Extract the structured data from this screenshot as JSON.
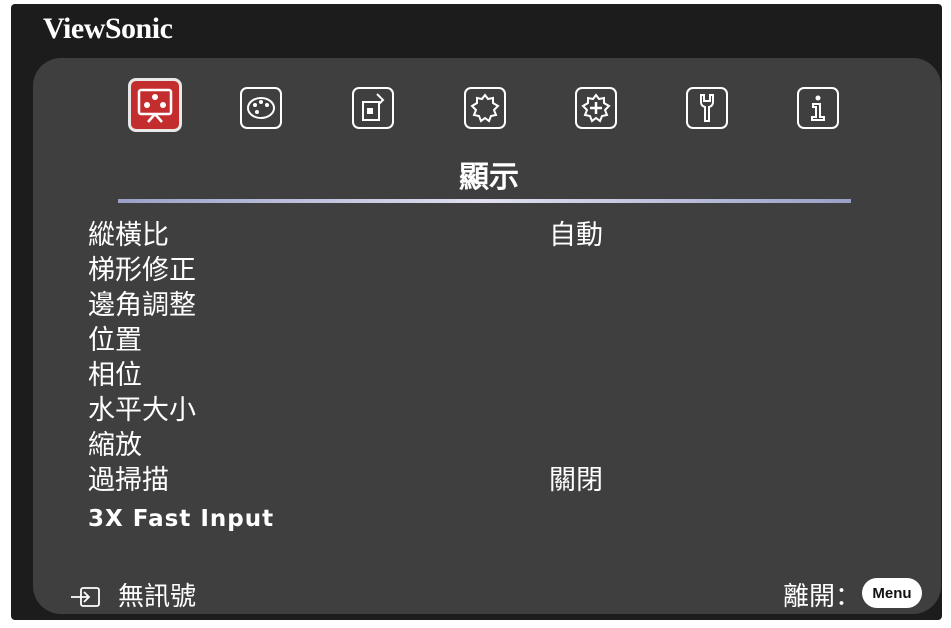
{
  "app": {
    "brand": "ViewSonic"
  },
  "tabs": [
    {
      "icon": "display-icon",
      "active": true
    },
    {
      "icon": "picture-icon",
      "active": false
    },
    {
      "icon": "power-management-icon",
      "active": false
    },
    {
      "icon": "basic-settings-icon",
      "active": false
    },
    {
      "icon": "advanced-settings-icon",
      "active": false
    },
    {
      "icon": "system-icon",
      "active": false
    },
    {
      "icon": "information-icon",
      "active": false
    }
  ],
  "active_tab_title": "顯示",
  "menu": {
    "items": [
      {
        "label": "縱橫比",
        "value": "自動"
      },
      {
        "label": "梯形修正",
        "value": ""
      },
      {
        "label": "邊角調整",
        "value": ""
      },
      {
        "label": "位置",
        "value": ""
      },
      {
        "label": "相位",
        "value": ""
      },
      {
        "label": "水平大小",
        "value": ""
      },
      {
        "label": "縮放",
        "value": ""
      },
      {
        "label": "過掃描",
        "value": "關閉"
      },
      {
        "label": "3X Fast Input",
        "value": ""
      }
    ]
  },
  "footer": {
    "input_icon": "input-source-icon",
    "status": "無訊號",
    "exit_label": "離開：",
    "menu_key": "Menu"
  },
  "colors": {
    "background": "#1c1c1c",
    "panel": "#3f3f3f",
    "active_tab": "#c42d2d",
    "text": "#ffffff"
  }
}
